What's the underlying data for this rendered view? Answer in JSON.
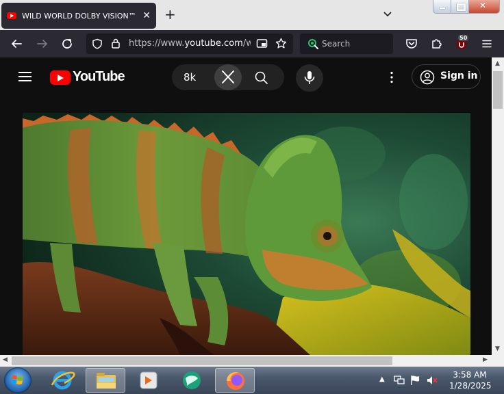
{
  "browser": {
    "tab": {
      "title": "WILD WORLD DOLBY VISION™"
    },
    "new_tab": "+",
    "url": {
      "prefix": "https://www.",
      "domain": "youtube.com",
      "rest": "/w"
    },
    "search_placeholder": "Search",
    "extension_badge": "50",
    "colors": {
      "chrome": "#2b2a33",
      "field": "#1c1b22",
      "tabstrip": "#e6e6e6"
    }
  },
  "youtube": {
    "logo_text": "YouTube",
    "search_query": "8k",
    "signin_label": "Sign in",
    "colors": {
      "bg": "#0f0f0f",
      "red": "#ff0000"
    },
    "video": {
      "subject": "veiled chameleon on branch"
    }
  },
  "taskbar": {
    "clock_time": "3:58 AM",
    "clock_date": "1/28/2025",
    "apps": [
      "start-orb",
      "internet-explorer-icon",
      "file-explorer-icon",
      "media-player-icon",
      "chat-app-icon",
      "firefox-icon"
    ]
  }
}
